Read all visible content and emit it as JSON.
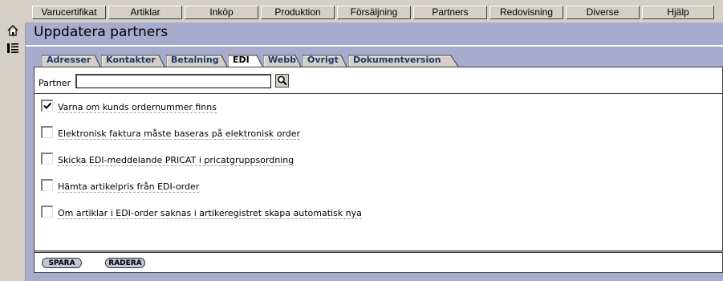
{
  "menu": {
    "items": [
      {
        "label": "Varucertifikat"
      },
      {
        "label": "Artiklar"
      },
      {
        "label": "Inköp"
      },
      {
        "label": "Produktion"
      },
      {
        "label": "Försäljning"
      },
      {
        "label": "Partners"
      },
      {
        "label": "Redovisning"
      },
      {
        "label": "Diverse"
      },
      {
        "label": "Hjälp"
      }
    ]
  },
  "sidebar": {
    "icons": [
      "home-icon",
      "list-icon"
    ]
  },
  "page": {
    "title": "Uppdatera partners"
  },
  "tabs": [
    {
      "label": "Adresser"
    },
    {
      "label": "Kontakter"
    },
    {
      "label": "Betalning"
    },
    {
      "label": "EDI",
      "active": true
    },
    {
      "label": "Webb"
    },
    {
      "label": "Övrigt"
    },
    {
      "label": "Dokumentversion"
    }
  ],
  "partner": {
    "label": "Partner",
    "value": "",
    "search_icon": "magnifier-icon"
  },
  "options": [
    {
      "label": "Varna om kunds ordernummer finns",
      "checked": true
    },
    {
      "label": "Elektronisk faktura måste baseras på elektronisk order",
      "checked": false
    },
    {
      "label": "Skicka EDI-meddelande PRICAT i pricatgruppsordning",
      "checked": false
    },
    {
      "label": "Hämta artikelpris från EDI-order",
      "checked": false
    },
    {
      "label": "Om artiklar i EDI-order saknas i artikeregistret skapa automatisk nya",
      "checked": false
    }
  ],
  "actions": {
    "save_label": "SPARA",
    "delete_label": "RADERA"
  },
  "colors": {
    "content_background": "#a7abce",
    "tab_text": "#1d3a6e",
    "chrome": "#d4d0c8"
  }
}
